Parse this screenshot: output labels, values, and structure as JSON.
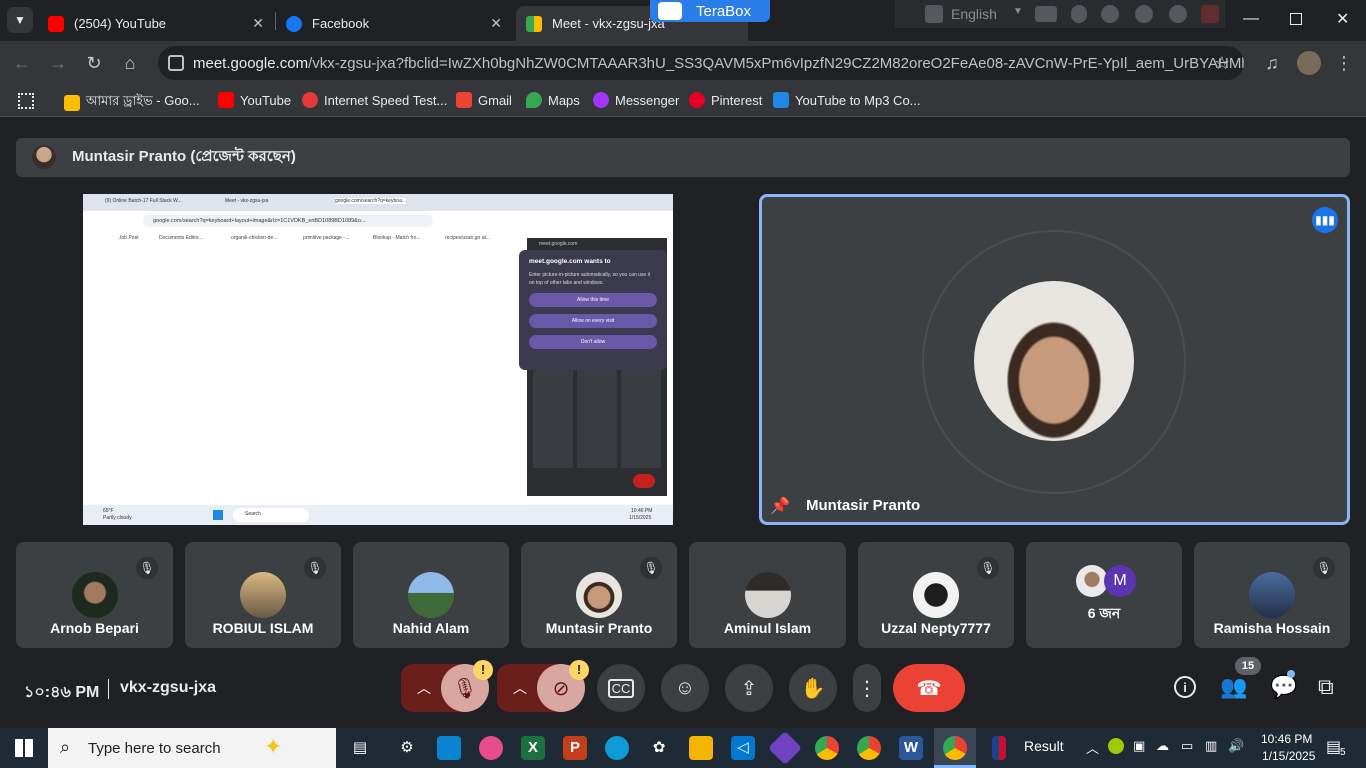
{
  "tabs": [
    {
      "title": "(2504) YouTube",
      "active": false,
      "favicon_color": "#ff0000"
    },
    {
      "title": "Facebook",
      "active": false,
      "favicon_color": "#1877f2"
    },
    {
      "title": "Meet - vkx-zgsu-jxa",
      "active": true,
      "favicon_color": "#34a853"
    }
  ],
  "overlay": {
    "terabox_label": "TeraBox",
    "language_label": "English"
  },
  "address_bar": {
    "host": "meet.google.com",
    "path": "/vkx-zgsu-jxa?fbclid=IwZXh0bgNhZW0CMTAAAR3hU_SS3QAVM5xPm6vIpzfN29CZ2M82oreO2FeAe08-zAVCnW-PrE-YpIl_aem_UrBYAHMh__u1u..."
  },
  "bookmarks": [
    {
      "label": "আমার ড্রাইভ - Goo...",
      "color": "#fbbc04"
    },
    {
      "label": "YouTube",
      "color": "#ff0000"
    },
    {
      "label": "Internet Speed Test...",
      "color": "#e53935"
    },
    {
      "label": "Gmail",
      "color": "#ea4335"
    },
    {
      "label": "Maps",
      "color": "#34a853"
    },
    {
      "label": "Messenger",
      "color": "#a334fa"
    },
    {
      "label": "Pinterest",
      "color": "#e60023"
    },
    {
      "label": "YouTube to Mp3 Co...",
      "color": "#1e88e5"
    }
  ],
  "meet": {
    "presenter_bar_text": "Muntasir Pranto (প্রেজেন্ট করছেন)",
    "spotlight_name": "Muntasir Pranto",
    "participants": [
      {
        "name": "Arnob Bepari",
        "muted": true
      },
      {
        "name": "ROBIUL ISLAM",
        "muted": true
      },
      {
        "name": "Nahid Alam",
        "muted": true
      },
      {
        "name": "Muntasir Pranto",
        "muted": true
      },
      {
        "name": "Aminul Islam",
        "muted": true
      },
      {
        "name": "Uzzal Nepty7777",
        "muted": true
      },
      {
        "name": "6 জন",
        "muted": false,
        "extra_initial": "M"
      },
      {
        "name": "Ramisha Hossain",
        "muted": true
      }
    ],
    "time": "১০:৪৬ PM",
    "meeting_code": "vkx-zgsu-jxa",
    "participant_count": "15",
    "warn_mark": "!"
  },
  "shared_screen": {
    "tabs": [
      "(9) Online Batch-17 Full Stack W...",
      "Meet - vkx-zgsu-jxa",
      "google.com/search?q=keyboa..."
    ],
    "url": "google.com/search?q=keyboard+layout+image&rlz=1C1VDKB_enBD1089BD1089&o...",
    "bookmarks": [
      "Job Post",
      "Documents Editor...",
      "organik-chicken-de...",
      "primitive package -...",
      "Blookup - Match fro...",
      "recipes/usan.go at..."
    ],
    "popup_origin": "meet.google.com",
    "popup_title": "meet.google.com wants to",
    "popup_desc": "Enter picture-in-picture automatically, so you can use it on top of other tabs and windows.",
    "popup_buttons": [
      "Allow this time",
      "Allow on every visit",
      "Don't allow"
    ],
    "weather_temp": "65°F",
    "weather_text": "Partly cloudy",
    "search_label": "Search",
    "clock_time": "10:46 PM",
    "clock_date": "1/15/2025"
  },
  "taskbar": {
    "search_placeholder": "Type here to search",
    "result_label": "Result",
    "time": "10:46 PM",
    "date": "1/15/2025",
    "notification_count": "5"
  }
}
